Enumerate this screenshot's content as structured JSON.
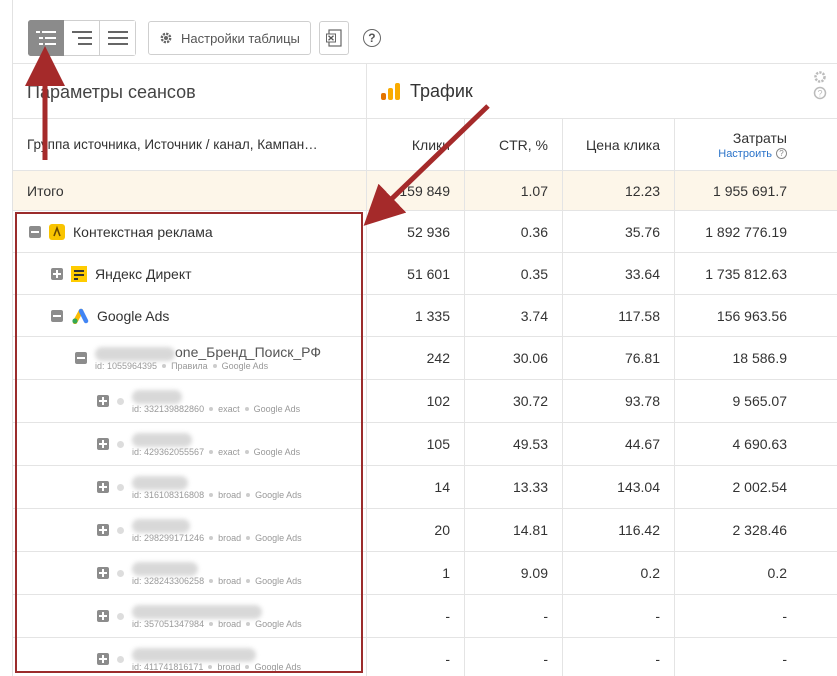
{
  "toolbar": {
    "settings_label": "Настройки таблицы",
    "help_label": "?"
  },
  "header": {
    "params_title": "Параметры сеансов",
    "traffic_title": "Трафик",
    "group_label": "Группа источника, Источник / канал, Кампан…",
    "col_clicks": "Клики",
    "col_ctr": "CTR, %",
    "col_cpc": "Цена клика",
    "col_cost": "Затраты",
    "cost_setup": "Настроить"
  },
  "total": {
    "label": "Итого",
    "clicks": "159 849",
    "ctr": "1.07",
    "cpc": "12.23",
    "cost": "1 955 691.7"
  },
  "groups": [
    {
      "label": "Контекстная реклама",
      "clicks": "52 936",
      "ctr": "0.36",
      "cpc": "35.76",
      "cost": "1 892 776.19"
    },
    {
      "label": "Яндекс Директ",
      "clicks": "51 601",
      "ctr": "0.35",
      "cpc": "33.64",
      "cost": "1 735 812.63"
    },
    {
      "label": "Google Ads",
      "clicks": "1 335",
      "ctr": "3.74",
      "cpc": "117.58",
      "cost": "156 963.56"
    }
  ],
  "campaign": {
    "name_visible": "one_Бренд_Поиск_РФ",
    "id": "id: 1055964395",
    "tag1": "Правила",
    "tag2": "Google Ads",
    "clicks": "242",
    "ctr": "30.06",
    "cpc": "76.81",
    "cost": "18 586.9"
  },
  "keywords": [
    {
      "id": "id: 332139882860",
      "match": "exact",
      "src": "Google Ads",
      "clicks": "102",
      "ctr": "30.72",
      "cpc": "93.78",
      "cost": "9 565.07"
    },
    {
      "id": "id: 429362055567",
      "match": "exact",
      "src": "Google Ads",
      "clicks": "105",
      "ctr": "49.53",
      "cpc": "44.67",
      "cost": "4 690.63"
    },
    {
      "id": "id: 316108316808",
      "match": "broad",
      "src": "Google Ads",
      "clicks": "14",
      "ctr": "13.33",
      "cpc": "143.04",
      "cost": "2 002.54"
    },
    {
      "id": "id: 298299171246",
      "match": "broad",
      "src": "Google Ads",
      "clicks": "20",
      "ctr": "14.81",
      "cpc": "116.42",
      "cost": "2 328.46"
    },
    {
      "id": "id: 328243306258",
      "match": "broad",
      "src": "Google Ads",
      "clicks": "1",
      "ctr": "9.09",
      "cpc": "0.2",
      "cost": "0.2"
    },
    {
      "id": "id: 357051347984",
      "match": "broad",
      "src": "Google Ads",
      "clicks": "-",
      "ctr": "-",
      "cpc": "-",
      "cost": "-"
    },
    {
      "id": "id: 411741816171",
      "match": "broad",
      "src": "Google Ads",
      "clicks": "-",
      "ctr": "-",
      "cpc": "-",
      "cost": "-"
    }
  ],
  "colors": {
    "accent": "#2b73c9",
    "total_bg": "#fdf6e9",
    "annotation": "#9b2c2c"
  }
}
